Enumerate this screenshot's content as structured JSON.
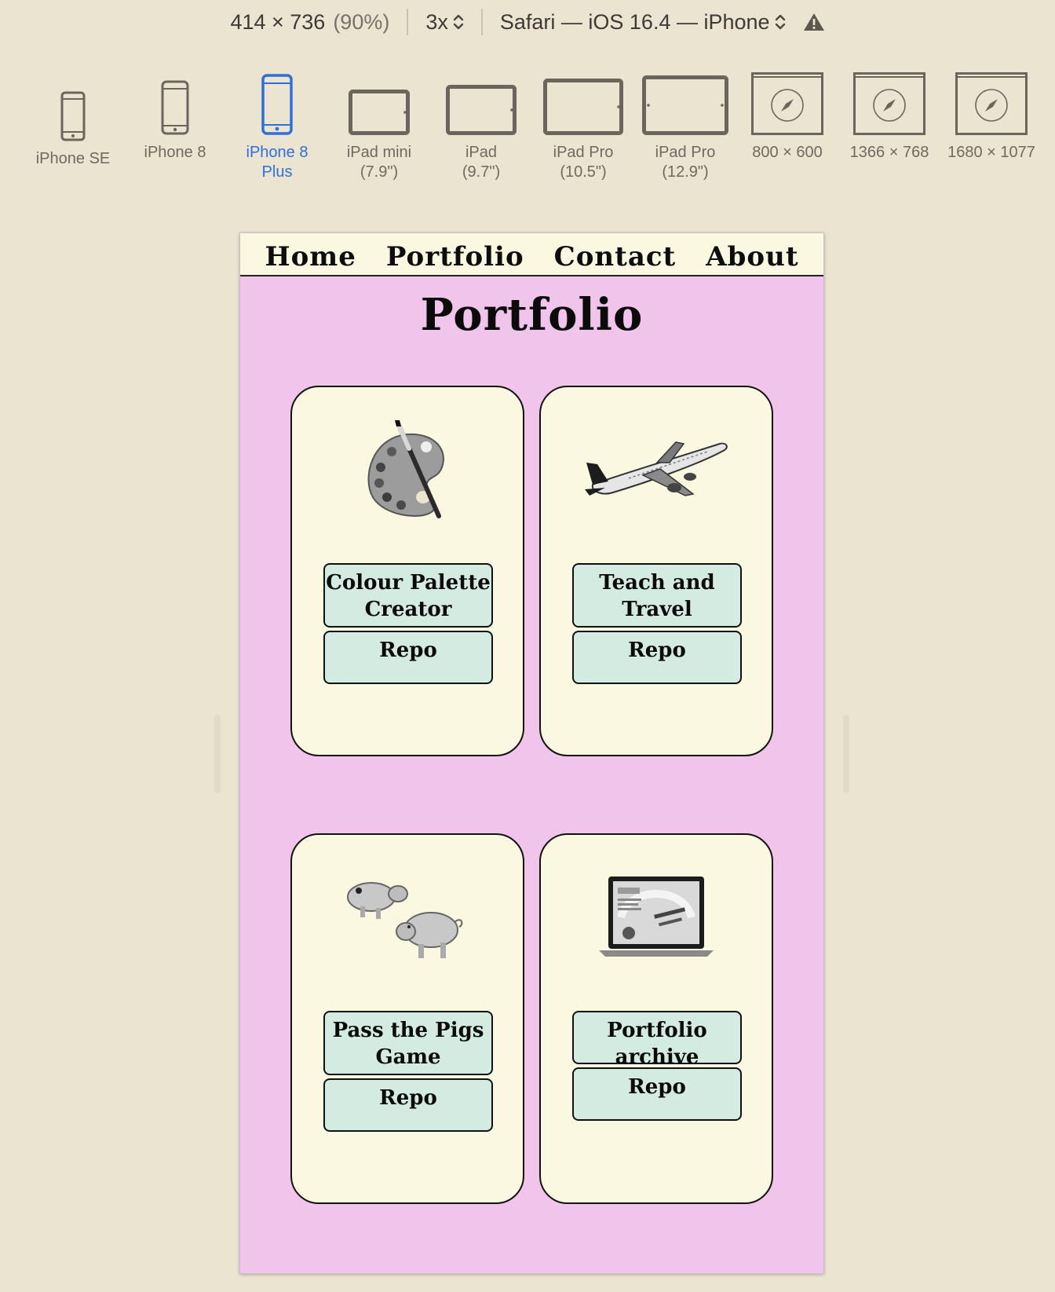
{
  "toolbar": {
    "dimensions": "414 × 736",
    "zoom": "(90%)",
    "scale": "3x",
    "browser": "Safari — iOS 16.4 — iPhone"
  },
  "devices": [
    {
      "label": "iPhone SE",
      "icon": "phone-icon"
    },
    {
      "label": "iPhone 8",
      "icon": "phone-icon"
    },
    {
      "label": "iPhone 8\nPlus",
      "icon": "phone-icon",
      "active": true
    },
    {
      "label": "iPad mini\n(7.9\")",
      "icon": "tablet-icon"
    },
    {
      "label": "iPad\n(9.7\")",
      "icon": "tablet-icon"
    },
    {
      "label": "iPad Pro\n(10.5\")",
      "icon": "tablet-icon"
    },
    {
      "label": "iPad Pro\n(12.9\")",
      "icon": "tablet-icon"
    },
    {
      "label": "800 × 600",
      "icon": "safari-compass-icon"
    },
    {
      "label": "1366 × 768",
      "icon": "safari-compass-icon"
    },
    {
      "label": "1680 × 1077",
      "icon": "safari-compass-icon"
    }
  ],
  "site": {
    "nav": [
      "Home",
      "Portfolio",
      "Contact",
      "About"
    ],
    "title": "Portfolio",
    "cards": [
      {
        "title": "Colour Palette\nCreator",
        "repo": "Repo",
        "image": "paint-palette-icon"
      },
      {
        "title": "Teach and\nTravel",
        "repo": "Repo",
        "image": "airplane-icon"
      },
      {
        "title": "Pass the Pigs\nGame",
        "repo": "Repo",
        "image": "pigs-icon"
      },
      {
        "title": "Portfolio archive",
        "repo": "Repo",
        "image": "laptop-icon"
      }
    ]
  },
  "colors": {
    "background": "#ebe4d1",
    "active_blue": "#2f6fdc",
    "page_pink": "#f1c4eb",
    "card_cream": "#fbf8e2",
    "button_mint": "#d4ebe2"
  }
}
